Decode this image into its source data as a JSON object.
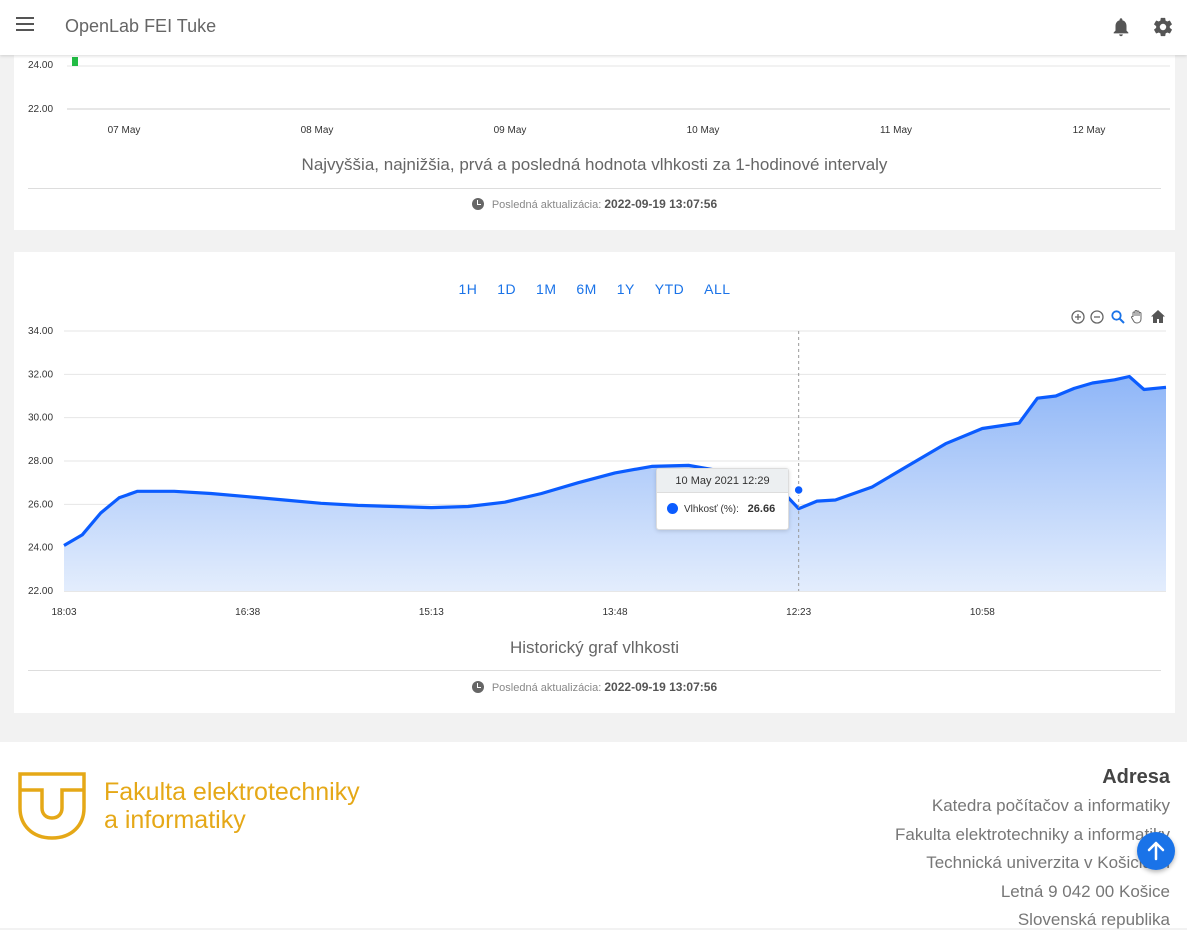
{
  "header": {
    "title": "OpenLab FEI Tuke",
    "icons": [
      "menu-icon",
      "bell-icon",
      "gear-icon"
    ]
  },
  "top_chart": {
    "y_ticks": [
      "24.00",
      "22.00"
    ],
    "x_ticks": [
      "07 May",
      "08 May",
      "09 May",
      "10 May",
      "11 May",
      "12 May"
    ],
    "caption": "Najvyššia, najnižšia, prvá a posledná hodnota vlhkosti za 1-hodinové intervaly",
    "update_label": "Posledná aktualizácia:",
    "update_value": "2022-09-19 13:07:56",
    "colors": {
      "candle": "#22bb44"
    }
  },
  "history_chart": {
    "ranges": [
      "1H",
      "1D",
      "1M",
      "6M",
      "1Y",
      "YTD",
      "ALL"
    ],
    "toolbar_icons": [
      "zoom-in-icon",
      "zoom-out-icon",
      "selection-zoom-icon",
      "pan-hand-icon",
      "reset-home-icon"
    ],
    "tooltip": {
      "title": "10 May 2021 12:29",
      "series_label": "Vlhkosť (%):",
      "value": "26.66"
    },
    "caption": "Historický graf vlhkosti",
    "update_label": "Posledná aktualizácia:",
    "update_value": "2022-09-19 13:07:56",
    "colors": {
      "line": "#0b5cff",
      "fill_top": "#8fb6f7",
      "fill_bottom": "#e3edfd"
    }
  },
  "chart_data": [
    {
      "type": "area",
      "title": "Historický graf vlhkosti",
      "ylim": [
        22,
        34
      ],
      "y_ticks": [
        22,
        24,
        26,
        28,
        30,
        32,
        34
      ],
      "x_ticks": [
        "18:03",
        "16:38",
        "15:13",
        "13:48",
        "12:23",
        "10:58"
      ],
      "series": [
        {
          "name": "Vlhkosť (%)",
          "x": [
            0.0,
            0.5,
            1.0,
            1.5,
            2.0,
            3.0,
            4.0,
            5.0,
            6.0,
            7.0,
            8.0,
            9.0,
            10.0,
            11.0,
            12.0,
            13.0,
            14.0,
            15.0,
            16.0,
            17.0,
            18.0,
            19.0,
            19.5,
            20.0,
            20.5,
            21.0,
            22.0,
            23.0,
            24.0,
            25.0,
            26.0,
            26.5,
            27.0,
            27.5,
            28.0,
            28.6,
            29.0,
            29.4,
            30.0
          ],
          "values": [
            24.1,
            24.6,
            25.6,
            26.3,
            26.6,
            26.6,
            26.5,
            26.35,
            26.2,
            26.05,
            25.95,
            25.9,
            25.85,
            25.9,
            26.1,
            26.5,
            27.0,
            27.45,
            27.75,
            27.8,
            27.5,
            26.8,
            26.7,
            25.8,
            26.15,
            26.2,
            26.8,
            27.8,
            28.8,
            29.5,
            29.75,
            30.9,
            31.0,
            31.35,
            31.6,
            31.75,
            31.9,
            31.3,
            31.4
          ]
        }
      ]
    }
  ],
  "footer": {
    "faculty_line1": "Fakulta elektrotechniky",
    "faculty_line2": "a informatiky",
    "address_title": "Adresa",
    "address_lines": [
      "Katedra počítačov a informatiky",
      "Fakulta elektrotechniky a informatiky",
      "Technická univerzita v Košiciach",
      "Letná 9 042 00 Košice",
      "Slovenská republika"
    ],
    "colors": {
      "brand": "#e5a817"
    }
  }
}
